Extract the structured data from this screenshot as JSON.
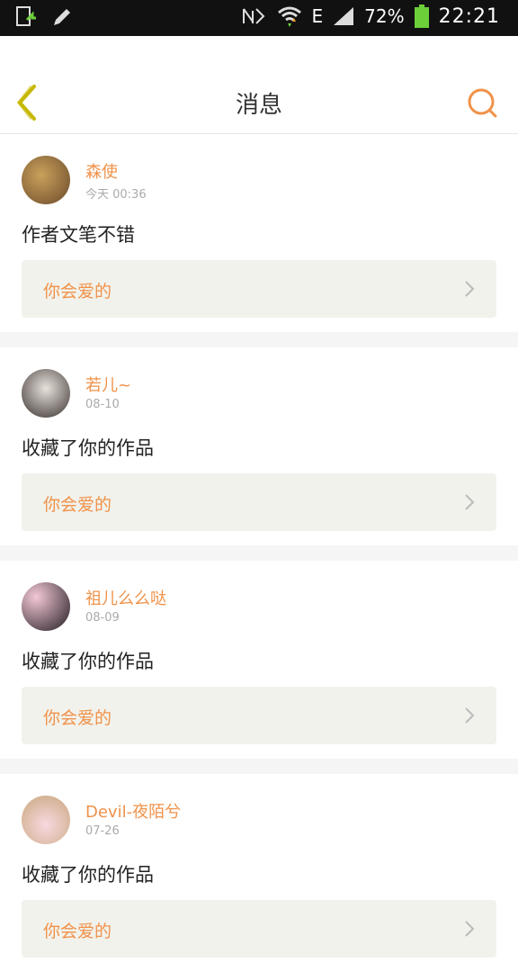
{
  "status_bar": {
    "battery": "72%",
    "network": "E",
    "time": "22:21"
  },
  "header": {
    "title": "消息"
  },
  "messages": [
    {
      "name": "森使",
      "time": "今天 00:36",
      "text": "作者文笔不错",
      "recommend": "你会爱的",
      "avatar_colors": [
        "#c9a15c",
        "#6b4a2a"
      ]
    },
    {
      "name": "若儿~",
      "time": "08-10",
      "text": "收藏了你的作品",
      "recommend": "你会爱的",
      "avatar_colors": [
        "#e8e2dc",
        "#3a3230"
      ]
    },
    {
      "name": "祖儿么么哒",
      "time": "08-09",
      "text": "收藏了你的作品",
      "recommend": "你会爱的",
      "avatar_colors": [
        "#f3c8d6",
        "#231c22"
      ]
    },
    {
      "name": "Devil-夜陌兮",
      "time": "07-26",
      "text": "收藏了你的作品",
      "recommend": "你会爱的",
      "avatar_colors": [
        "#f7d9e0",
        "#c9a67c"
      ]
    }
  ],
  "colors": {
    "accent": "#f0924a",
    "back_arrow": "#c6b800",
    "card_bg": "#f2f2ec"
  }
}
